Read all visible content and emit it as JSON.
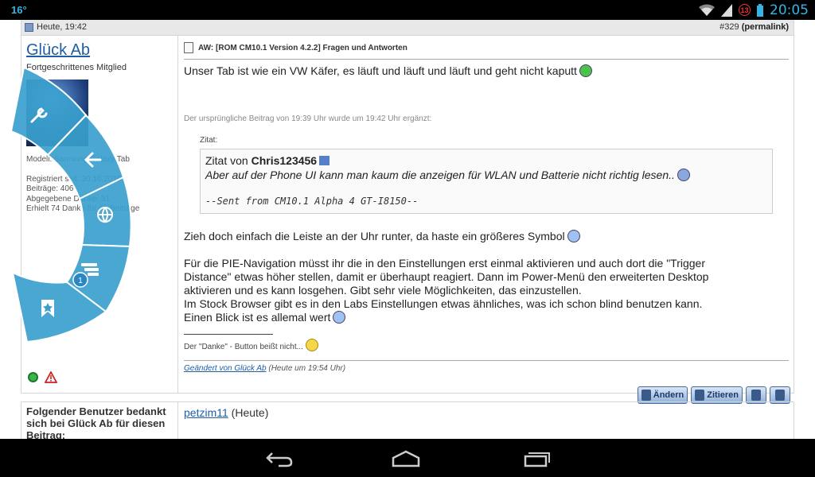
{
  "status_bar": {
    "left_indicator": "16°",
    "notification_count": "13",
    "time": "20:05"
  },
  "post": {
    "date": "Heute, 19:42",
    "number_prefix": "#329",
    "permalink": "(permalink)",
    "author": {
      "name": "Glück Ab",
      "title": "Fortgeschrittenes Mitglied",
      "info_lines": [
        "Modell: Samsung Galaxy Tab",
        "",
        "Registriert seit: 30.10.2010",
        "Beiträge: 406",
        "Abgegebene Danke: 31",
        "Erhielt 74 Danke für 61 Beiträge"
      ]
    },
    "title": "AW: [ROM CM10.1 Version 4.2.2] Fragen und Antworten",
    "body_line1": "Unser Tab ist wie ein VW Käfer, es läuft und läuft und läuft und geht nicht kaputt",
    "merge_note": "Der ursprüngliche Beitrag von 19:39 Uhr wurde um 19:42 Uhr ergänzt:",
    "quote_label": "Zitat:",
    "quote": {
      "from_prefix": "Zitat von",
      "from_user": "Chris123456",
      "text": "Aber auf der Phone UI kann man kaum die anzeigen für WLAN und Batterie nicht richtig lesen..",
      "signature": "--Sent from CM10.1 Alpha 4 GT-I8150--"
    },
    "body_line2": "Zieh doch einfach die Leiste an der Uhr runter, da haste ein größeres Symbol",
    "paragraph": [
      "Für die PIE-Navigation müsst ihr die in den Einstellungen erst einmal aktivieren und auch dort die \"Trigger",
      "Distance\" etwas höher stellen, damit er überhaupt reagiert. Dann im Power-Menü den erweiterten Desktop",
      "aktivieren und es kann losgehen. Gibt sehr viele Möglichkeiten, das einzustellen.",
      "Im Stock Browser gibt es in den Labs Einstellungen etwas ähnliches, was ich schon blind benutzen kann.",
      "Einen Blick ist es allemal wert"
    ],
    "signature": "Der \"Danke\" - Button beißt nicht...",
    "edited_by": "Geändert von Glück Ab",
    "edited_time": "(Heute um 19:54 Uhr)",
    "buttons": {
      "edit": "Ändern",
      "quote": "Zitieren"
    }
  },
  "thanks": {
    "heading": "Folgender Benutzer bedankt sich bei Glück Ab für diesen Beitrag:",
    "user": "petzim11",
    "when": "(Heute)"
  },
  "pie": {
    "badge": "1"
  },
  "colors": {
    "link": "#1f5ea6",
    "pie": "#3a9fcd",
    "status_accent": "#33b5e5"
  }
}
